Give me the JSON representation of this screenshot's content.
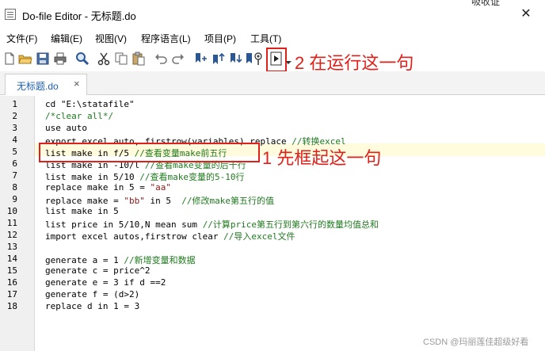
{
  "window": {
    "title": "Do-file Editor - 无标题.do",
    "top_right_label": "吸收证",
    "close_symbol": "✕"
  },
  "menu": [
    "文件(F)",
    "编辑(E)",
    "视图(V)",
    "程序语言(L)",
    "项目(P)",
    "工具(T)"
  ],
  "toolbar": {
    "icons": [
      "new-file-icon",
      "open-folder-icon",
      "save-icon",
      "print-icon",
      "find-icon",
      "cut-icon",
      "copy-icon",
      "paste-icon",
      "undo-icon",
      "redo-icon",
      "bookmark-toggle-icon",
      "bookmark-prev-icon",
      "bookmark-next-icon",
      "bookmark-clear-icon",
      "preview-icon",
      "execute-icon",
      "execute-dropdown-icon"
    ]
  },
  "tab": {
    "label": "无标题.do",
    "close": "×"
  },
  "editor": {
    "current_line": 5,
    "lines": [
      {
        "n": "1",
        "parts": [
          {
            "t": "cd \"E:\\statafile\"",
            "c": "plain"
          }
        ]
      },
      {
        "n": "2",
        "parts": [
          {
            "t": "/*clear all*/",
            "c": "cmt"
          }
        ]
      },
      {
        "n": "3",
        "parts": [
          {
            "t": "use auto",
            "c": "plain"
          }
        ]
      },
      {
        "n": "4",
        "parts": [
          {
            "t": "export excel auto, firstrow(variables) replace ",
            "c": "plain"
          },
          {
            "t": "//转换excel",
            "c": "cmt"
          }
        ]
      },
      {
        "n": "5",
        "parts": [
          {
            "t": "list make in f/5 ",
            "c": "plain"
          },
          {
            "t": "//查看变量make前五行",
            "c": "cmt"
          }
        ]
      },
      {
        "n": "6",
        "parts": [
          {
            "t": "list make in -10/l ",
            "c": "plain"
          },
          {
            "t": "//查看make变量的后十行",
            "c": "cmt"
          }
        ]
      },
      {
        "n": "7",
        "parts": [
          {
            "t": "list make in 5/10 ",
            "c": "plain"
          },
          {
            "t": "//查看make变量的5-10行",
            "c": "cmt"
          }
        ]
      },
      {
        "n": "8",
        "parts": [
          {
            "t": "replace make in 5 = ",
            "c": "plain"
          },
          {
            "t": "\"aa\"",
            "c": "str"
          }
        ]
      },
      {
        "n": "9",
        "parts": [
          {
            "t": "replace make = ",
            "c": "plain"
          },
          {
            "t": "\"bb\"",
            "c": "str"
          },
          {
            "t": " in 5  ",
            "c": "plain"
          },
          {
            "t": "//修改make第五行的值",
            "c": "cmt"
          }
        ]
      },
      {
        "n": "10",
        "parts": [
          {
            "t": "list make in 5",
            "c": "plain"
          }
        ]
      },
      {
        "n": "11",
        "parts": [
          {
            "t": "list price in 5/10,N mean sum ",
            "c": "plain"
          },
          {
            "t": "//计算price第五行到第六行的数量均值总和",
            "c": "cmt"
          }
        ]
      },
      {
        "n": "12",
        "parts": [
          {
            "t": "import excel autos,firstrow clear ",
            "c": "plain"
          },
          {
            "t": "//导入excel文件",
            "c": "cmt"
          }
        ]
      },
      {
        "n": "13",
        "parts": []
      },
      {
        "n": "14",
        "parts": [
          {
            "t": "generate a = 1 ",
            "c": "plain"
          },
          {
            "t": "//新增变量和数据",
            "c": "cmt"
          }
        ]
      },
      {
        "n": "15",
        "parts": [
          {
            "t": "generate c = price^2",
            "c": "plain"
          }
        ]
      },
      {
        "n": "16",
        "parts": [
          {
            "t": "generate e = 3 if d ==2",
            "c": "plain"
          }
        ]
      },
      {
        "n": "17",
        "parts": [
          {
            "t": "generate f = (d>2)",
            "c": "plain"
          }
        ]
      },
      {
        "n": "18",
        "parts": [
          {
            "t": "replace d in 1 = 3",
            "c": "plain"
          }
        ]
      }
    ]
  },
  "annotations": {
    "step2": "2  在运行这一句",
    "step1": "1 先框起这一句"
  },
  "watermark": "CSDN @玛丽莲佳超级好看",
  "colors": {
    "annotation": "#e0201a",
    "comment": "#1f7a1f",
    "string": "#8b1a1a",
    "tab_label": "#1a5fb4",
    "current_line_bg": "#fffbdc"
  }
}
